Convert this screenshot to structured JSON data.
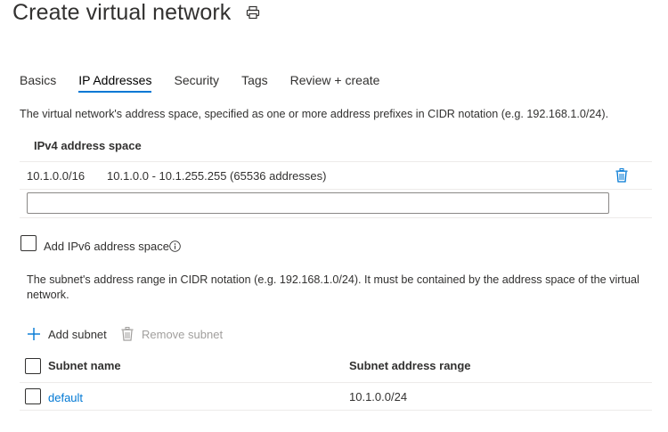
{
  "header": {
    "title": "Create virtual network",
    "print_icon": "print-icon"
  },
  "tabs": [
    {
      "label": "Basics",
      "active": false
    },
    {
      "label": "IP Addresses",
      "active": true
    },
    {
      "label": "Security",
      "active": false
    },
    {
      "label": "Tags",
      "active": false
    },
    {
      "label": "Review + create",
      "active": false
    }
  ],
  "address_space": {
    "description": "The virtual network's address space, specified as one or more address prefixes in CIDR notation (e.g. 192.168.1.0/24).",
    "column_header": "IPv4 address space",
    "rows": [
      {
        "prefix": "10.1.0.0/16",
        "range": "10.1.0.0 - 10.1.255.255 (65536 addresses)",
        "delete_icon": "trash-icon"
      }
    ],
    "new_value": "",
    "new_placeholder": ""
  },
  "ipv6": {
    "label": "Add IPv6 address space",
    "checked": false,
    "info_icon": "info-icon"
  },
  "subnets": {
    "description": "The subnet's address range in CIDR notation (e.g. 192.168.1.0/24). It must be contained by the address space of the virtual network.",
    "add_label": "Add subnet",
    "remove_label": "Remove subnet",
    "headers": {
      "name": "Subnet name",
      "range": "Subnet address range"
    },
    "rows": [
      {
        "name": "default",
        "range": "10.1.0.0/24",
        "checked": false
      }
    ]
  },
  "colors": {
    "accent": "#0078d4",
    "text": "#323130",
    "disabled": "#a19f9d",
    "border": "#edebe9"
  }
}
